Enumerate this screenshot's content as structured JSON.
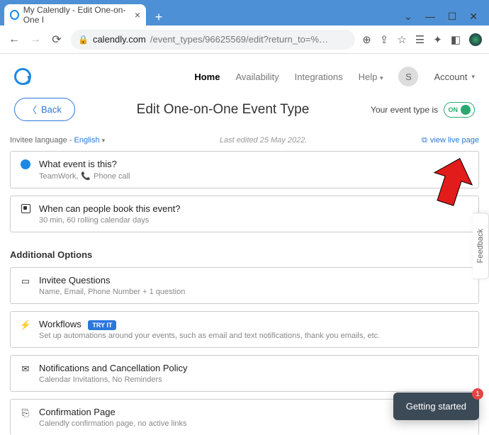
{
  "browser": {
    "tab_title": "My Calendly - Edit One-on-One I",
    "url_host": "calendly.com",
    "url_path": "/event_types/96625569/edit?return_to=%…"
  },
  "nav": {
    "home": "Home",
    "availability": "Availability",
    "integrations": "Integrations",
    "help": "Help",
    "account": "Account",
    "avatar_initial": "S"
  },
  "page": {
    "back": "Back",
    "title": "Edit One-on-One Event Type",
    "status_label": "Your event type is",
    "toggle_state": "ON"
  },
  "meta": {
    "lang_prefix": "Invitee language - ",
    "lang_value": "English",
    "last_edited": "Last edited 25 May 2022.",
    "view_live": "view live page"
  },
  "cards": {
    "what": {
      "title": "What event is this?",
      "sub_name": "TeamWork,",
      "sub_phone": "Phone call"
    },
    "when": {
      "title": "When can people book this event?",
      "sub": "30 min, 60 rolling calendar days"
    }
  },
  "additional": {
    "heading": "Additional Options",
    "invitee": {
      "title": "Invitee Questions",
      "sub": "Name, Email, Phone Number + 1 question"
    },
    "workflows": {
      "title": "Workflows",
      "badge": "TRY IT",
      "sub": "Set up automations around your events, such as email and text notifications, thank you emails, etc."
    },
    "notifications": {
      "title": "Notifications and Cancellation Policy",
      "sub": "Calendar Invitations, No Reminders"
    },
    "confirmation": {
      "title": "Confirmation Page",
      "sub": "Calendly confirmation page, no active links"
    }
  },
  "ui": {
    "feedback": "Feedback",
    "getting_started": "Getting started",
    "getting_badge": "1"
  }
}
